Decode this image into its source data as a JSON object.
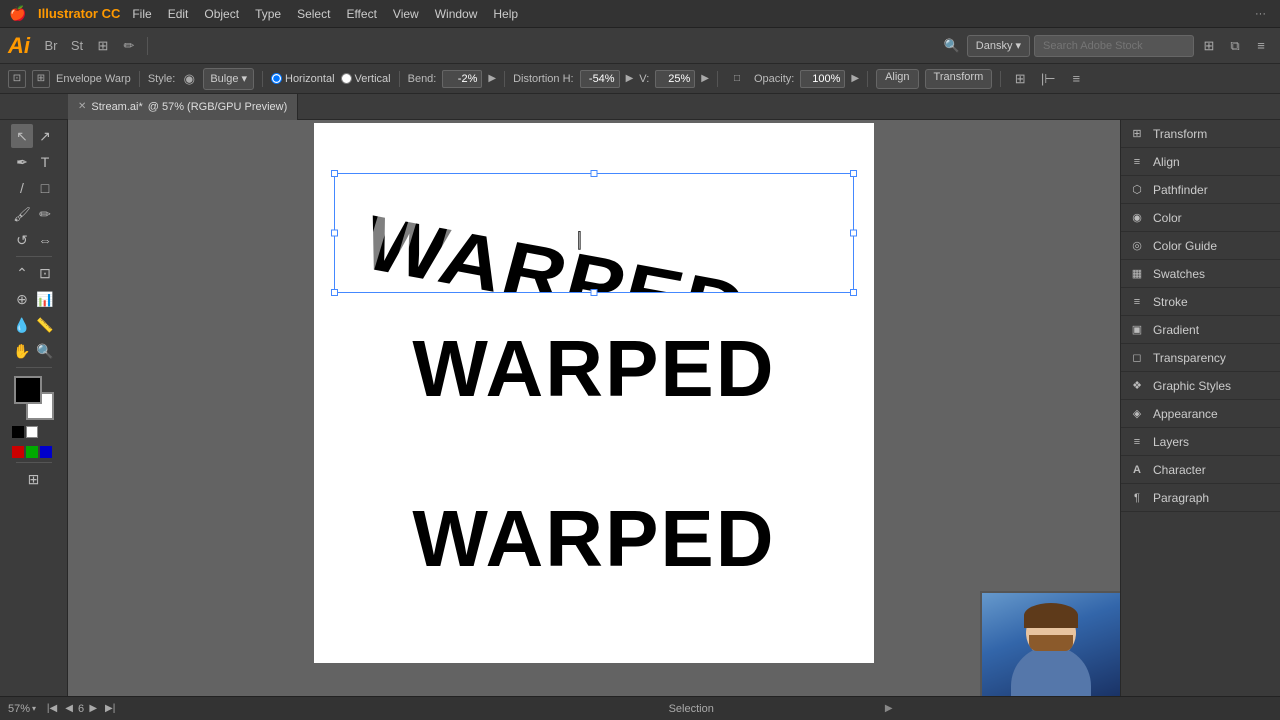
{
  "app": {
    "name": "Illustrator CC",
    "title": "Ai"
  },
  "menu": {
    "apple": "🍎",
    "items": [
      "Illustrator CC",
      "File",
      "Edit",
      "Object",
      "Type",
      "Select",
      "Effect",
      "View",
      "Window",
      "Help"
    ]
  },
  "toolbar2": {
    "logo": "Ai",
    "user": "Dansky",
    "search_placeholder": "Search Adobe Stock"
  },
  "options_bar": {
    "label": "Envelope Warp",
    "style_label": "Style:",
    "style_value": "Bulge",
    "horizontal_label": "Horizontal",
    "vertical_label": "Vertical",
    "bend_label": "Bend:",
    "bend_value": "-2%",
    "distortion_label": "Distortion H:",
    "distortion_h": "-54%",
    "distortion_v_label": "V:",
    "distortion_v": "25%",
    "opacity_label": "Opacity:",
    "opacity_value": "100%",
    "align_label": "Align",
    "transform_label": "Transform"
  },
  "tab": {
    "filename": "Stream.ai*",
    "info": "@ 57% (RGB/GPU Preview)"
  },
  "canvas": {
    "warped_text": "WARPED",
    "normal_text_1": "WARPED",
    "normal_text_2": "WARPED"
  },
  "right_panel": {
    "items": [
      {
        "id": "transform",
        "label": "Transform",
        "icon": "⊞"
      },
      {
        "id": "align",
        "label": "Align",
        "icon": "≡"
      },
      {
        "id": "pathfinder",
        "label": "Pathfinder",
        "icon": "⬡"
      },
      {
        "id": "color",
        "label": "Color",
        "icon": "◉"
      },
      {
        "id": "color-guide",
        "label": "Color Guide",
        "icon": "◎"
      },
      {
        "id": "swatches",
        "label": "Swatches",
        "icon": "▦"
      },
      {
        "id": "stroke",
        "label": "Stroke",
        "icon": "≡"
      },
      {
        "id": "gradient",
        "label": "Gradient",
        "icon": "▣"
      },
      {
        "id": "transparency",
        "label": "Transparency",
        "icon": "◻"
      },
      {
        "id": "graphic-styles",
        "label": "Graphic Styles",
        "icon": "❖"
      },
      {
        "id": "appearance",
        "label": "Appearance",
        "icon": "◈"
      },
      {
        "id": "layers",
        "label": "Layers",
        "icon": "≡"
      },
      {
        "id": "character",
        "label": "Character",
        "icon": "A"
      },
      {
        "id": "paragraph",
        "label": "Paragraph",
        "icon": "¶"
      }
    ]
  },
  "status_bar": {
    "zoom": "57%",
    "page": "6",
    "tool": "Selection"
  }
}
